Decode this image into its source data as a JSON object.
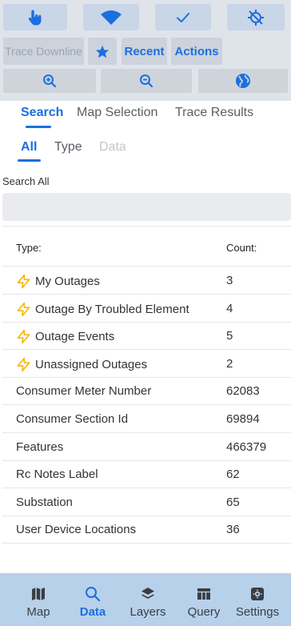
{
  "toolbar": {
    "row1_icons": [
      "touch-pointer-icon",
      "wifi-icon",
      "checkmark-icon",
      "gps-off-icon"
    ],
    "trace_downline_label": "Trace Downline",
    "favorites_icon": "star-icon",
    "recent_label": "Recent",
    "actions_label": "Actions",
    "row3_icons": [
      "zoom-in-icon",
      "zoom-out-icon",
      "globe-icon"
    ]
  },
  "tabs": [
    "Search",
    "Map Selection",
    "Trace Results"
  ],
  "active_tab": "Search",
  "subtabs": [
    "All",
    "Type",
    "Data"
  ],
  "active_subtab": "All",
  "search": {
    "label": "Search All",
    "value": "",
    "placeholder": ""
  },
  "table": {
    "headers": {
      "type": "Type:",
      "count": "Count:"
    },
    "rows": [
      {
        "type": "My Outages",
        "count": "3",
        "icon": "lightning-icon"
      },
      {
        "type": "Outage By Troubled Element",
        "count": "4",
        "icon": "lightning-icon"
      },
      {
        "type": "Outage Events",
        "count": "5",
        "icon": "lightning-icon"
      },
      {
        "type": "Unassigned Outages",
        "count": "2",
        "icon": "lightning-icon"
      },
      {
        "type": "Consumer Meter Number",
        "count": "62083"
      },
      {
        "type": "Consumer Section Id",
        "count": "69894"
      },
      {
        "type": "Features",
        "count": "466379"
      },
      {
        "type": "Rc Notes Label",
        "count": "62"
      },
      {
        "type": "Substation",
        "count": "65"
      },
      {
        "type": "User Device Locations",
        "count": "36"
      }
    ]
  },
  "bottom_nav": [
    {
      "label": "Map",
      "icon": "map-icon"
    },
    {
      "label": "Data",
      "icon": "search-icon"
    },
    {
      "label": "Layers",
      "icon": "layers-icon"
    },
    {
      "label": "Query",
      "icon": "table-icon"
    },
    {
      "label": "Settings",
      "icon": "settings-icon"
    }
  ],
  "active_nav": "Data",
  "colors": {
    "accent": "#1b6fe0",
    "lightning": "#f2b600",
    "toolbar_bg": "#dfe3ea",
    "nav_bg": "#b8d1ea"
  }
}
